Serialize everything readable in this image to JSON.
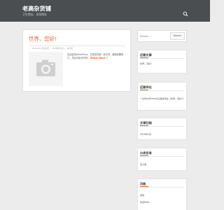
{
  "header": {
    "site_title": "老高杂货铺",
    "site_description": "卫生地址、但领地址",
    "search_icon": "search-icon"
  },
  "post": {
    "title": "世界，您好!",
    "meta": "Posted by 老高杂货 — 2018年2月2日 — 未分类",
    "thumbnail_icon": "camera-icon",
    "excerpt": "欢迎使用WordPress。这是您的第一篇文章。编辑或删除它，然后开始写作吧！",
    "read_more": "Read More »"
  },
  "sidebar": {
    "search": {
      "placeholder": "Search …",
      "button_label": "Search"
    },
    "recent_posts": {
      "title": "近期文章",
      "items": [
        "世界，您好!"
      ]
    },
    "recent_comments": {
      "title": "近期评论",
      "items": [
        "一位WordPress评论者发表在《世界，您好!》"
      ]
    },
    "archives": {
      "title": "文章归档",
      "items": [
        "2018年2月"
      ]
    },
    "categories": {
      "title": "分类目录",
      "items": [
        "未分类"
      ]
    },
    "meta": {
      "title": "功能",
      "items": [
        "登录",
        "条目feed"
      ]
    }
  },
  "colors": {
    "header_background": "#4a4e51",
    "accent": "#f05a28",
    "page_background": "#ececec"
  }
}
